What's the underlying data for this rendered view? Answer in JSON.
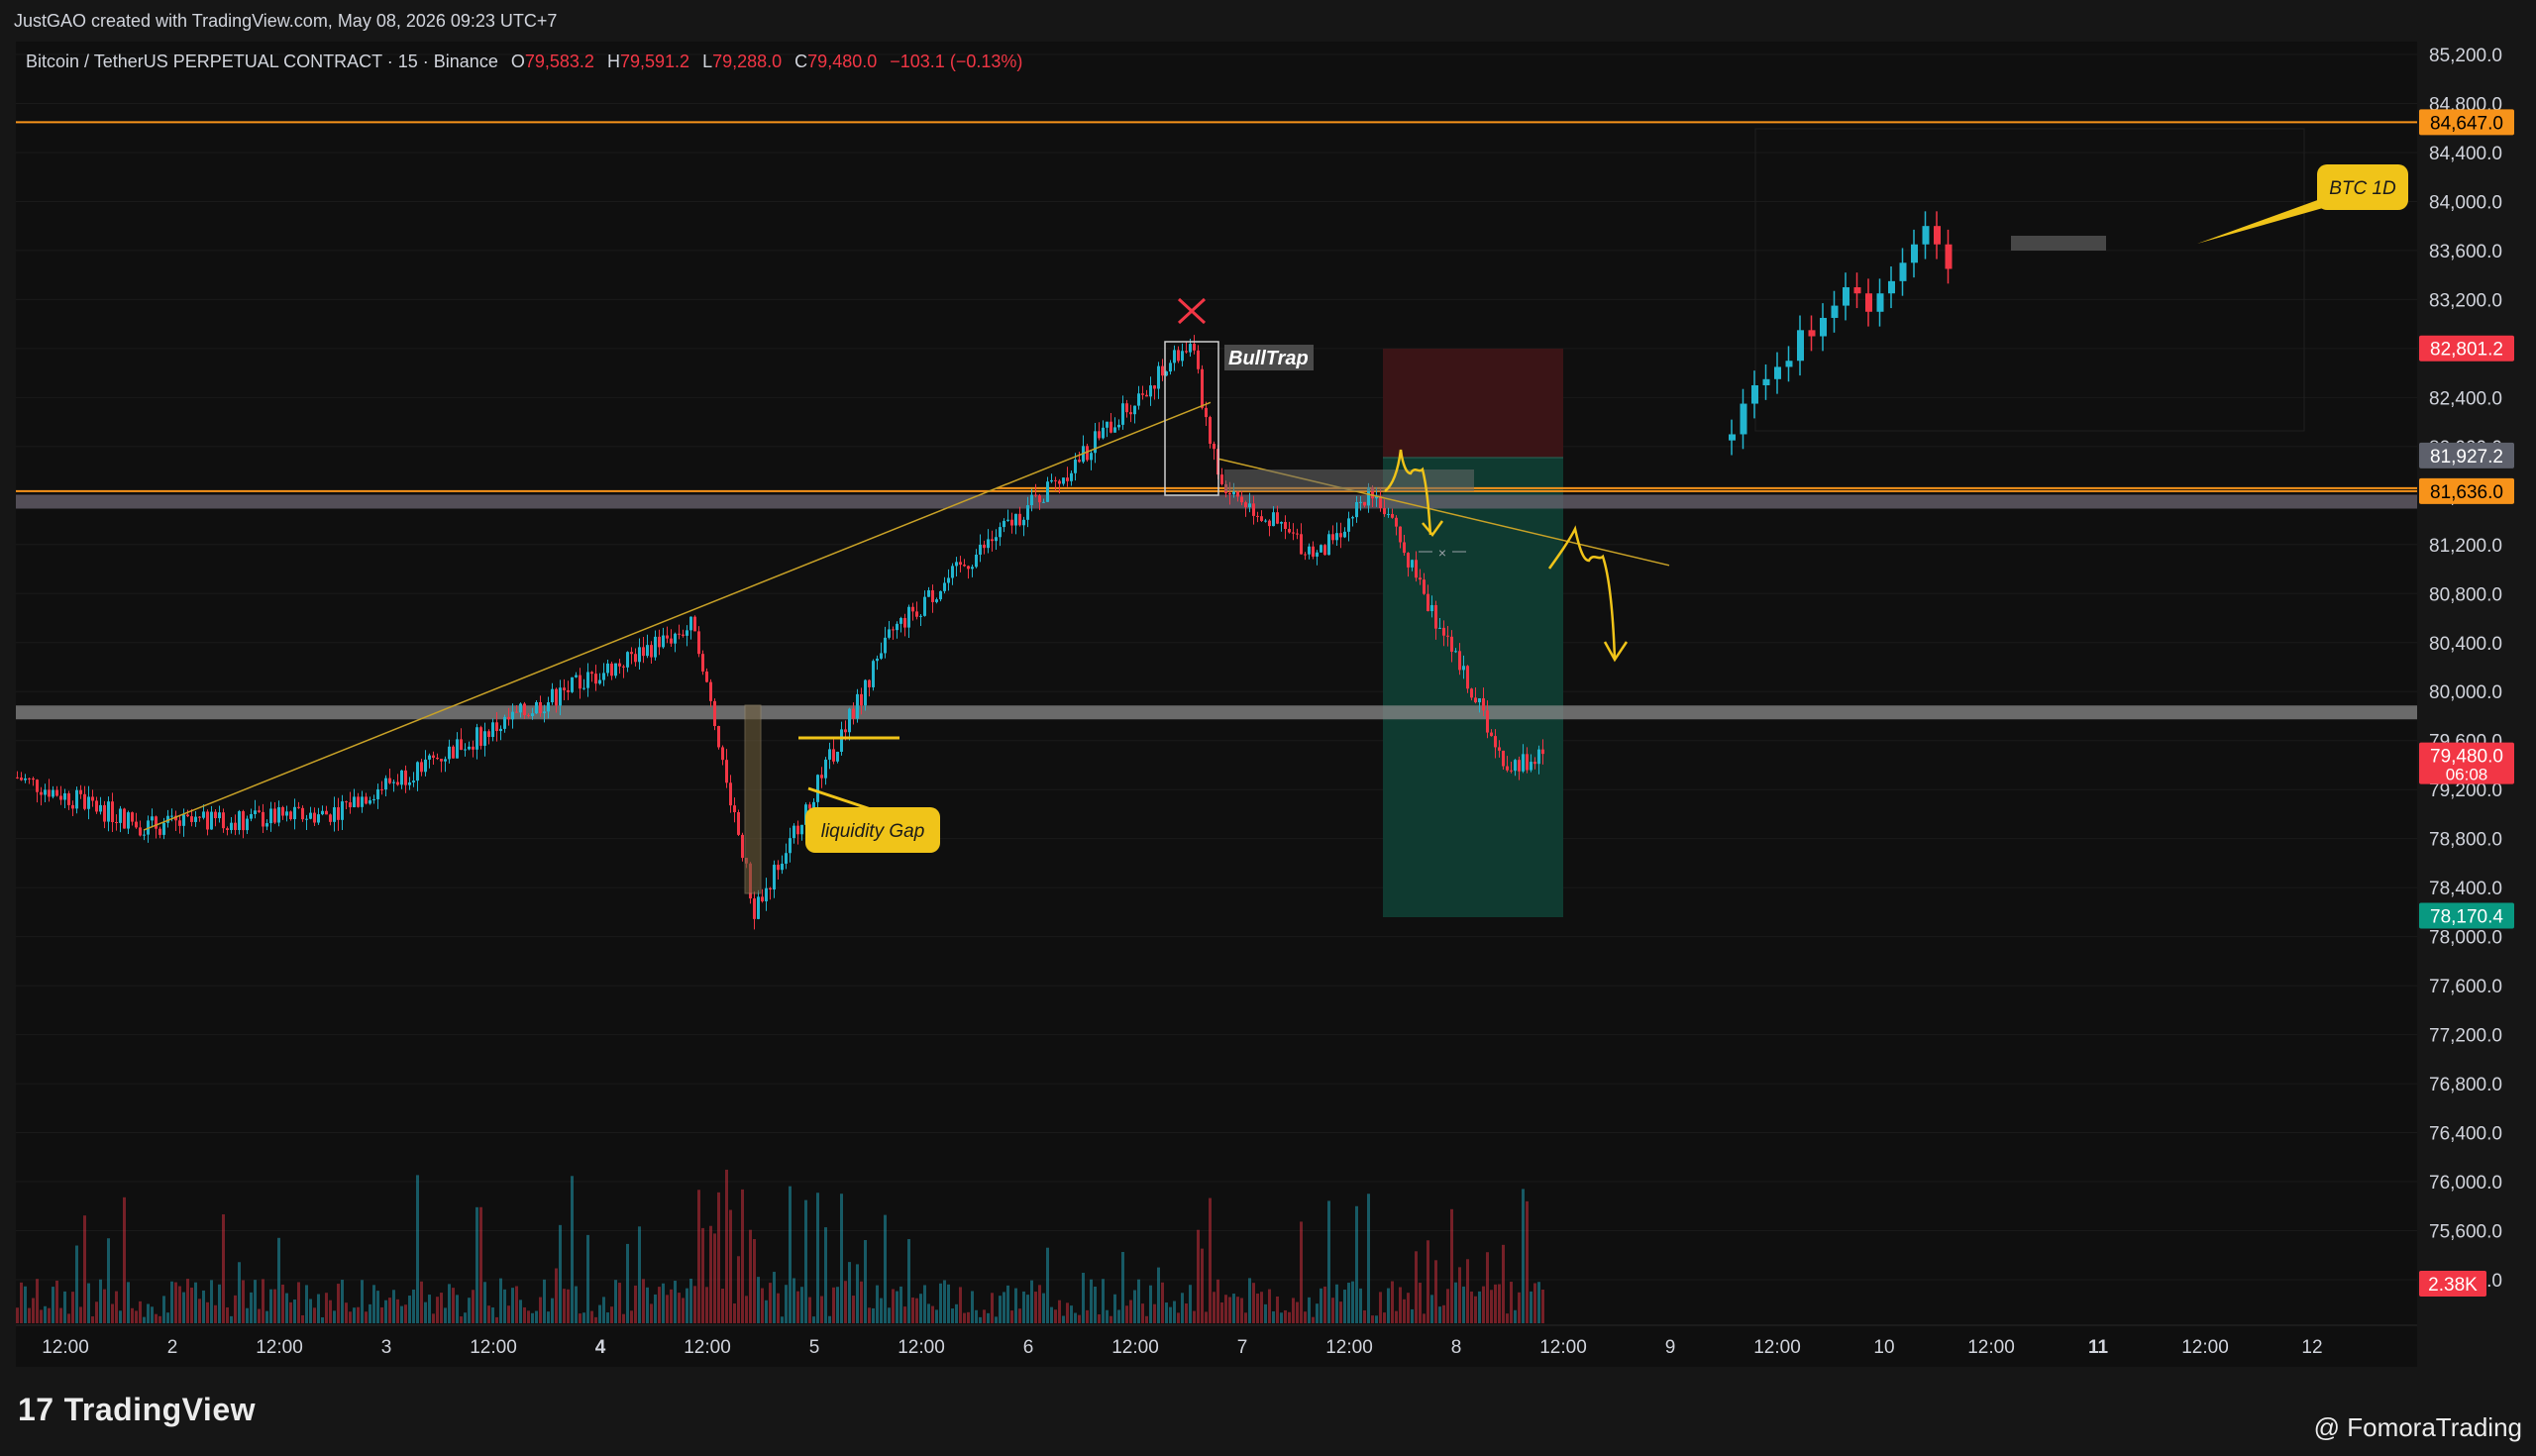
{
  "header": {
    "created_by": "JustGAO created with TradingView.com, May 08, 2026 09:23 UTC+7"
  },
  "symbol": {
    "name": "Bitcoin / TetherUS PERPETUAL CONTRACT · 15 · Binance",
    "open_label": "O",
    "open": "79,583.2",
    "high_label": "H",
    "high": "79,591.2",
    "low_label": "L",
    "low": "79,288.0",
    "close_label": "C",
    "close": "79,480.0",
    "change": "−103.1 (−0.13%)"
  },
  "colors": {
    "up": "#22b5cf",
    "down": "#f23645",
    "annotation": "#f0c419",
    "tp_zone": "#0f3a30",
    "sl_zone": "#3a1416"
  },
  "chart_data": {
    "type": "candlestick",
    "y_axis": {
      "ticks": [
        "85,200.0",
        "84,800.0",
        "84,400.0",
        "84,000.0",
        "83,600.0",
        "83,200.0",
        "82,800.0",
        "82,400.0",
        "82,000.0",
        "81,600.0",
        "81,200.0",
        "80,800.0",
        "80,400.0",
        "80,000.0",
        "79,600.0",
        "79,200.0",
        "78,800.0",
        "78,400.0",
        "78,000.0",
        "77,600.0",
        "77,200.0",
        "76,800.0",
        "76,400.0",
        "76,000.0",
        "75,600.0",
        "75,200.0"
      ],
      "tick_values": [
        85200,
        84800,
        84400,
        84000,
        83600,
        83200,
        82800,
        82400,
        82000,
        81600,
        81200,
        80800,
        80400,
        80000,
        79600,
        79200,
        78800,
        78400,
        78000,
        77600,
        77200,
        76800,
        76400,
        76000,
        75600,
        75200
      ],
      "range": [
        75100,
        85400
      ]
    },
    "x_axis": {
      "ticks": [
        "12:00",
        "2",
        "12:00",
        "3",
        "12:00",
        "4",
        "12:00",
        "5",
        "12:00",
        "6",
        "12:00",
        "7",
        "12:00",
        "8",
        "12:00",
        "9",
        "12:00",
        "10",
        "12:00",
        "11",
        "12:00",
        "12"
      ],
      "bold": [
        "4",
        "11"
      ]
    },
    "price_tags": [
      {
        "label": "84,647.0",
        "value": 84647.0,
        "color": "#f7931a",
        "text": "#000000"
      },
      {
        "label": "82,801.2",
        "value": 82801.2,
        "color": "#f23645",
        "text": "#ffffff"
      },
      {
        "label": "81,927.2",
        "value": 81927.2,
        "color": "#5d606b",
        "text": "#ffffff"
      },
      {
        "label": "81,636.0",
        "value": 81636.0,
        "color": "#f7931a",
        "text": "#000000"
      },
      {
        "label": "79,480.0",
        "sub": "06:08",
        "value": 79480.0,
        "color": "#f23645",
        "text": "#ffffff"
      },
      {
        "label": "78,170.4",
        "value": 78170.4,
        "color": "#089981",
        "text": "#ffffff"
      }
    ],
    "volume_tag": "2.38K",
    "key_prices": [
      {
        "value": 79300,
        "note": "start"
      },
      {
        "value": 78900,
        "note": "swing low day 2"
      },
      {
        "value": 79000,
        "note": "range day 2-3"
      },
      {
        "value": 80550,
        "note": "spike day 4"
      },
      {
        "value": 78200,
        "note": "liquidity low"
      },
      {
        "value": 80500,
        "note": "recovery day 5"
      },
      {
        "value": 81750,
        "note": "range day 6"
      },
      {
        "value": 82850,
        "note": "bull trap high"
      },
      {
        "value": 81700,
        "note": "rejection"
      },
      {
        "value": 81100,
        "note": "day 7 low"
      },
      {
        "value": 81650,
        "note": "retest"
      },
      {
        "value": 79400,
        "note": "day 8 low"
      },
      {
        "value": 79480,
        "note": "last close"
      }
    ],
    "levels": [
      {
        "value": 84647.0,
        "kind": "line",
        "color": "#f7931a"
      },
      {
        "value": 81636.0,
        "kind": "line",
        "color": "#f7931a"
      },
      {
        "value": 81550,
        "kind": "zone",
        "color": "#6b6470"
      },
      {
        "value": 79830,
        "kind": "zone",
        "color": "#8a8a8a"
      }
    ]
  },
  "annotations": {
    "bulltrap": "BullTrap",
    "liquidity_gap": "liquidity Gap",
    "btc_1d": "BTC 1D",
    "cross_mark": "×"
  },
  "footer": {
    "brand": "TradingView",
    "watermark": "@ FomoraTrading"
  }
}
